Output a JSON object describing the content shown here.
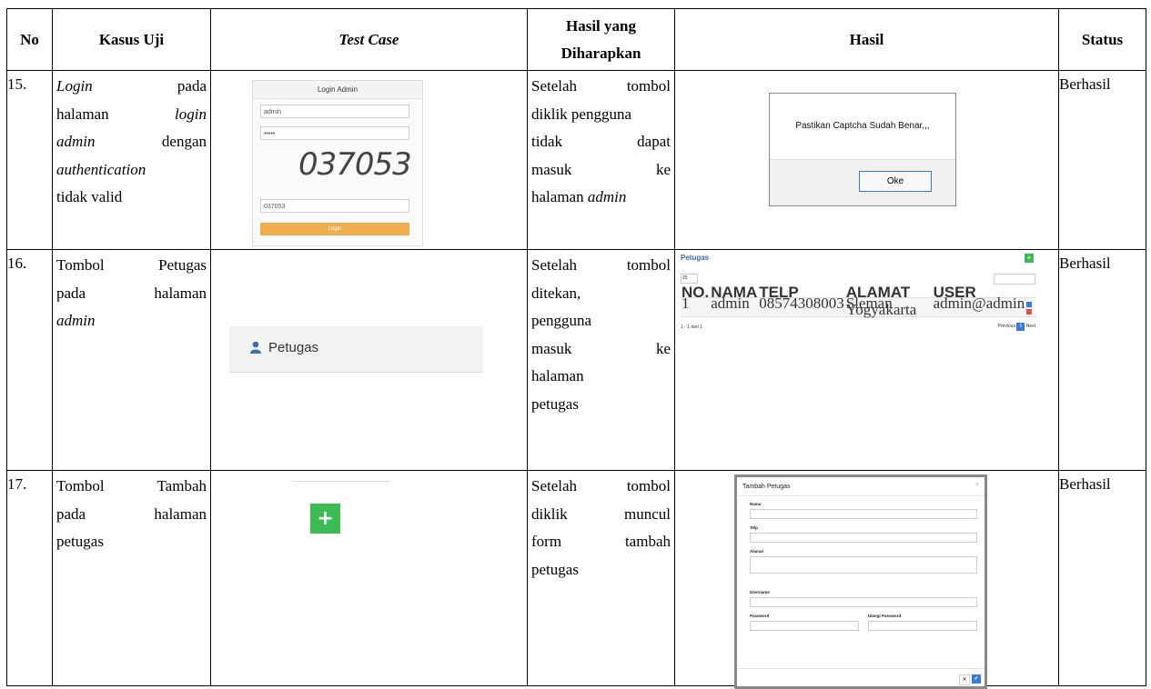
{
  "header": {
    "no": "No",
    "kasus_uji": "Kasus Uji",
    "test_case": "Test Case",
    "hasil_diharapkan_1": "Hasil yang",
    "hasil_diharapkan_2": "Diharapkan",
    "hasil": "Hasil",
    "status": "Status"
  },
  "rows": [
    {
      "no": "15.",
      "kasus": [
        "Login",
        "pada",
        "halaman",
        "login",
        "admin",
        "dengan",
        "authentication",
        "tidak valid"
      ],
      "harapan": [
        "Setelah tombol",
        "diklik pengguna",
        "tidak dapat",
        "masuk ke",
        "halaman",
        "admin"
      ],
      "status": "Berhasil",
      "login_mock": {
        "title": "Login Admin",
        "username": "admin",
        "password": "•••••",
        "captcha": "037053",
        "captcha_input": "037053",
        "button": "Login"
      },
      "alert": {
        "message": "Pastikan Captcha Sudah Benar,,,",
        "ok": "Oke"
      }
    },
    {
      "no": "16.",
      "kasus": [
        "Tombol Petugas",
        "pada",
        "halaman",
        "admin"
      ],
      "harapan": [
        "Setelah tombol",
        "ditekan,",
        "pengguna",
        "masuk ke",
        "halaman",
        "petugas"
      ],
      "status": "Berhasil",
      "sidebar_label": "Petugas",
      "page": {
        "title": "Petugas",
        "select": "25",
        "headers": [
          "NO.",
          "NAMA",
          "TELP",
          "ALAMAT",
          "USER",
          ""
        ],
        "row": [
          "1",
          "admin",
          "08574308003",
          "Sleman Yogyakarta",
          "admin@admin"
        ],
        "info": "1 - 1 dari 1",
        "prev": "Previous",
        "page": "1",
        "next": "Next"
      }
    },
    {
      "no": "17.",
      "kasus": [
        "Tombol Tambah",
        "pada",
        "halaman",
        "petugas"
      ],
      "harapan": [
        "Setelah tombol",
        "diklik muncul",
        "form tambah",
        "petugas"
      ],
      "status": "Berhasil",
      "form": {
        "title": "Tambah Petugas",
        "close": "×",
        "nama": "Nama",
        "telp": "Telp",
        "alamat": "Alamat",
        "username": "Username",
        "password": "Password",
        "ulangi": "Ulangi Password",
        "cancel": "✕",
        "save": "✔"
      }
    }
  ]
}
